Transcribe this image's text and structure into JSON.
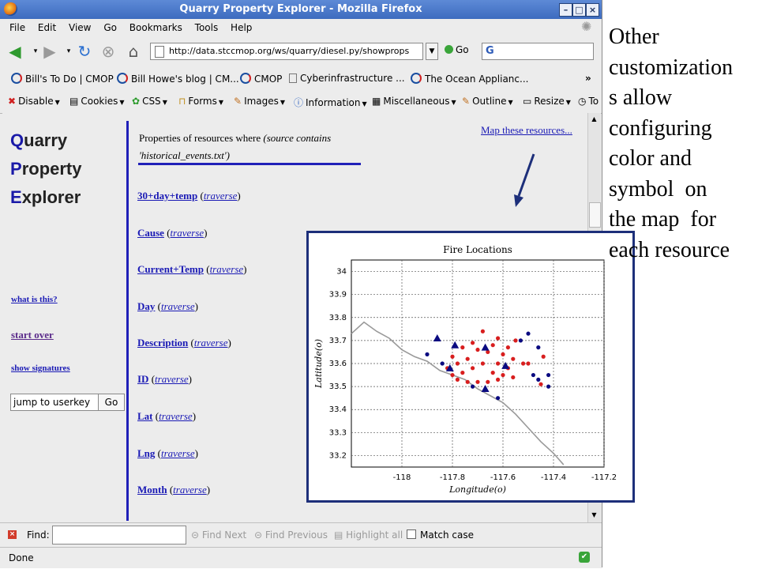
{
  "window": {
    "title": "Quarry Property Explorer - Mozilla Firefox"
  },
  "menu": [
    "File",
    "Edit",
    "View",
    "Go",
    "Bookmarks",
    "Tools",
    "Help"
  ],
  "nav": {
    "url": "http://data.stccmop.org/ws/quarry/diesel.py/showprops",
    "go_label": "Go",
    "search_logo": "G"
  },
  "bookmarks": [
    "Bill's To Do | CMOP",
    "Bill Howe's blog | CM...",
    "CMOP",
    "Cyberinfrastructure ...",
    "The Ocean Applianc...",
    "»"
  ],
  "devbar": [
    "Disable",
    "Cookies",
    "CSS",
    "Forms",
    "Images",
    "Information",
    "Miscellaneous",
    "Outline",
    "Resize",
    "To"
  ],
  "logo": [
    {
      "cap": "Q",
      "rest": "uarry"
    },
    {
      "cap": "P",
      "rest": "roperty"
    },
    {
      "cap": "E",
      "rest": "xplorer"
    }
  ],
  "sidebar": {
    "what_is_this": "what is this?",
    "start_over": "start over",
    "show_signatures": "show signatures",
    "jump_value": "jump to userkey",
    "jump_go": "Go"
  },
  "header": {
    "prefix": "Properties of resources where ",
    "condition_a": "(source contains",
    "condition_b": "'historical_events.txt')"
  },
  "map_link": "Map these resources...",
  "traverse_label": "traverse",
  "properties": [
    "30+day+temp",
    "Cause",
    "Current+Temp",
    "Day",
    "Description",
    "ID",
    "Lat",
    "Lng",
    "Month"
  ],
  "find": {
    "label": "Find:",
    "next": "Find Next",
    "previous": "Find Previous",
    "highlight": "Highlight all",
    "match_case": "Match case"
  },
  "status": {
    "text": "Done"
  },
  "annotation": [
    "Other",
    "customization",
    "s allow",
    "configuring",
    "color and",
    "symbol  on",
    "the map  for",
    "each resource"
  ],
  "colors": {
    "link": "#1a1ab5",
    "rule": "#2020b8",
    "red_series": "#d81e1e",
    "blue_series": "#0a0a80",
    "coast": "#999999"
  },
  "chart_data": {
    "type": "scatter",
    "title": "Fire Locations",
    "xlabel": "Longitude(o)",
    "ylabel": "Latitude(o)",
    "xlim": [
      -118.2,
      -117.2
    ],
    "ylim": [
      33.15,
      34.05
    ],
    "xticks": [
      "-118",
      "-117.8",
      "-117.6",
      "-117.4",
      "-117.2"
    ],
    "xtick_values": [
      -118,
      -117.8,
      -117.6,
      -117.4,
      -117.2
    ],
    "yticks": [
      "33.2",
      "33.3",
      "33.4",
      "33.5",
      "33.6",
      "33.7",
      "33.8",
      "33.9",
      "34"
    ],
    "ytick_values": [
      33.2,
      33.3,
      33.4,
      33.5,
      33.6,
      33.7,
      33.8,
      33.9,
      34.0
    ],
    "grid": true,
    "coastline": [
      [
        -118.2,
        33.73
      ],
      [
        -118.15,
        33.78
      ],
      [
        -118.1,
        33.74
      ],
      [
        -118.05,
        33.71
      ],
      [
        -118.0,
        33.66
      ],
      [
        -117.95,
        33.63
      ],
      [
        -117.9,
        33.61
      ],
      [
        -117.85,
        33.57
      ],
      [
        -117.8,
        33.55
      ],
      [
        -117.75,
        33.53
      ],
      [
        -117.7,
        33.49
      ],
      [
        -117.65,
        33.46
      ],
      [
        -117.6,
        33.43
      ],
      [
        -117.55,
        33.38
      ],
      [
        -117.5,
        33.32
      ],
      [
        -117.45,
        33.26
      ],
      [
        -117.4,
        33.21
      ],
      [
        -117.36,
        33.16
      ]
    ],
    "series": [
      {
        "marker": "circle",
        "color": "#d81e1e",
        "points": [
          [
            -117.68,
            33.74
          ],
          [
            -117.62,
            33.71
          ],
          [
            -117.55,
            33.7
          ],
          [
            -117.72,
            33.69
          ],
          [
            -117.64,
            33.68
          ],
          [
            -117.58,
            33.67
          ],
          [
            -117.76,
            33.67
          ],
          [
            -117.7,
            33.66
          ],
          [
            -117.66,
            33.65
          ],
          [
            -117.6,
            33.64
          ],
          [
            -117.8,
            33.63
          ],
          [
            -117.74,
            33.62
          ],
          [
            -117.56,
            33.62
          ],
          [
            -117.44,
            33.63
          ],
          [
            -117.78,
            33.6
          ],
          [
            -117.68,
            33.6
          ],
          [
            -117.62,
            33.6
          ],
          [
            -117.52,
            33.6
          ],
          [
            -117.82,
            33.58
          ],
          [
            -117.72,
            33.58
          ],
          [
            -117.58,
            33.58
          ],
          [
            -117.8,
            33.55
          ],
          [
            -117.76,
            33.56
          ],
          [
            -117.64,
            33.56
          ],
          [
            -117.6,
            33.55
          ],
          [
            -117.78,
            33.53
          ],
          [
            -117.74,
            33.52
          ],
          [
            -117.7,
            33.52
          ],
          [
            -117.66,
            33.52
          ],
          [
            -117.62,
            33.53
          ],
          [
            -117.56,
            33.54
          ],
          [
            -117.5,
            33.6
          ],
          [
            -117.45,
            33.51
          ]
        ]
      },
      {
        "marker": "circle",
        "color": "#0a0a80",
        "points": [
          [
            -117.53,
            33.7
          ],
          [
            -117.5,
            33.73
          ],
          [
            -117.46,
            33.67
          ],
          [
            -117.9,
            33.64
          ],
          [
            -117.84,
            33.6
          ],
          [
            -117.48,
            33.55
          ],
          [
            -117.46,
            33.53
          ],
          [
            -117.42,
            33.55
          ],
          [
            -117.42,
            33.5
          ],
          [
            -117.72,
            33.5
          ],
          [
            -117.62,
            33.45
          ]
        ]
      },
      {
        "marker": "triangle",
        "color": "#0a0a80",
        "points": [
          [
            -117.86,
            33.71
          ],
          [
            -117.79,
            33.68
          ],
          [
            -117.67,
            33.67
          ],
          [
            -117.81,
            33.58
          ],
          [
            -117.59,
            33.59
          ],
          [
            -117.67,
            33.49
          ]
        ]
      }
    ]
  }
}
